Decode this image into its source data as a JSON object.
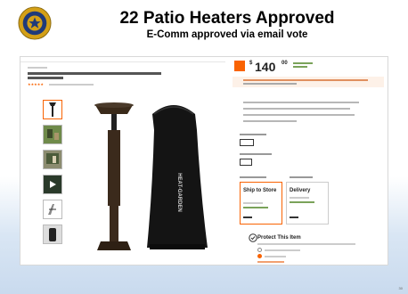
{
  "slide": {
    "title": "22 Patio Heaters Approved",
    "subtitle": "E-Comm approved via email vote",
    "page_number": "30"
  },
  "product": {
    "price_dollar": "$",
    "price": "140",
    "price_cents": "00",
    "ship_to_store": "Ship to Store",
    "delivery": "Delivery",
    "protect_title": "Protect This Item",
    "cover_text": "HEAT-GARDEN"
  },
  "colors": {
    "brand_orange": "#f96302",
    "seal_blue": "#1f3a7a",
    "seal_gold": "#d4a017"
  }
}
